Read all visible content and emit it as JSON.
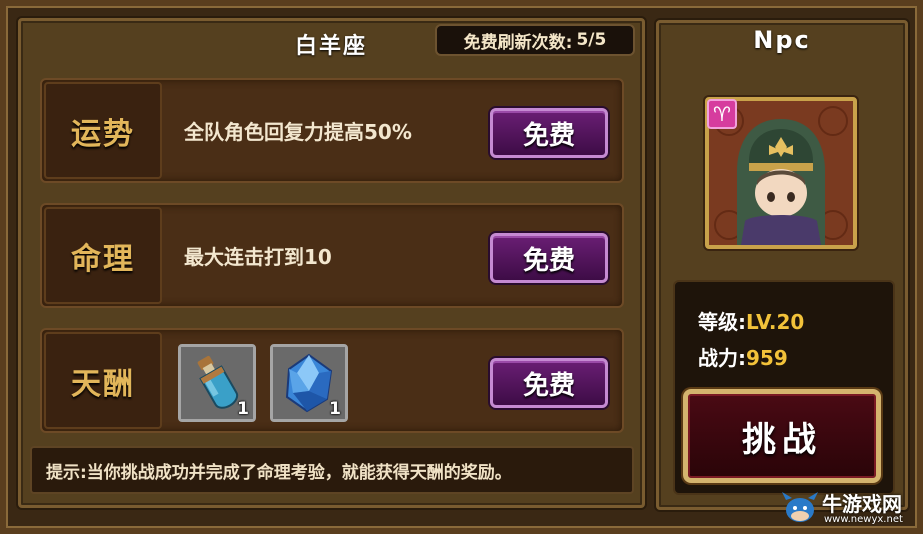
{
  "header": {
    "title": "白羊座",
    "refresh_label": "免费刷新次数:",
    "refresh_count": "5/5"
  },
  "rows": [
    {
      "label": "运势",
      "desc": "全队角色回复力提高50%",
      "button": "免费"
    },
    {
      "label": "命理",
      "desc": "最大连击打到10",
      "button": "免费"
    },
    {
      "label": "天酬",
      "button": "免费",
      "rewards": [
        {
          "icon": "potion-bottle-icon",
          "count": "1"
        },
        {
          "icon": "blue-crystal-icon",
          "count": "1"
        }
      ]
    }
  ],
  "tip": "提示:当你挑战成功并完成了命理考验，就能获得天酬的奖励。",
  "npc": {
    "title": "Npc",
    "zodiac_icon": "aries-icon",
    "zodiac_symbol": "♈",
    "level_label": "等级:",
    "level_value": "LV.20",
    "power_label": "战力:",
    "power_value": "959",
    "challenge_button": "挑战"
  },
  "watermark": {
    "main": "牛游戏网",
    "sub": "www.newyx.net"
  },
  "colors": {
    "accent_gold": "#f2c23a",
    "button_purple": "#6a1e74",
    "label_gold": "#e2b65a"
  }
}
